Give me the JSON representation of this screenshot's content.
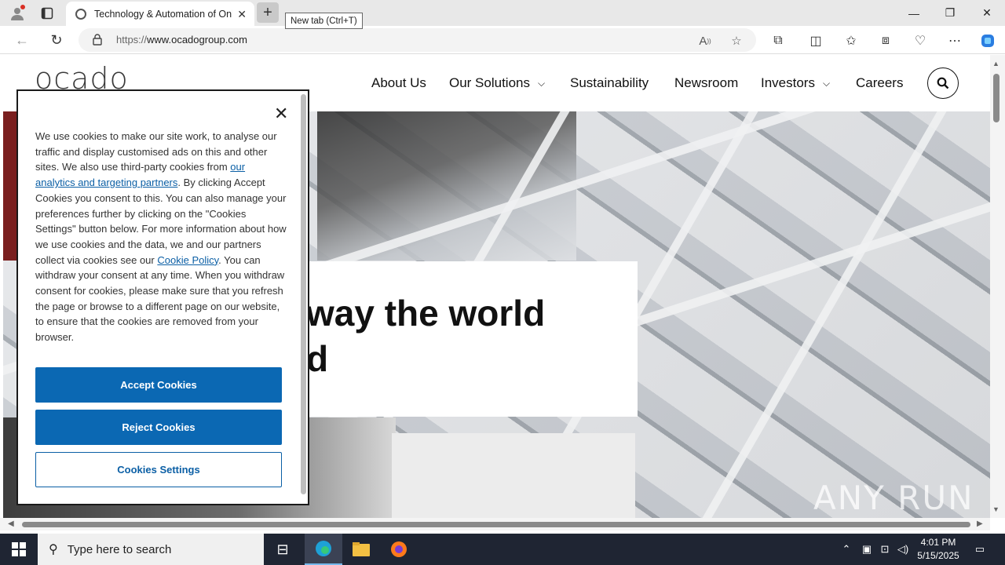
{
  "browser": {
    "tab_title": "Technology & Automation of Online Grocery",
    "tooltip": "New tab (Ctrl+T)",
    "url_prefix": "https://",
    "url_host": "www.ocadogroup.com"
  },
  "site": {
    "logo": "ocado",
    "nav": [
      "About Us",
      "Our Solutions",
      "Sustainability",
      "Newsroom",
      "Investors",
      "Careers"
    ],
    "hero_text": "way the world\nd"
  },
  "cookie": {
    "text_1": "We use cookies to make our site work, to analyse our traffic and display customised ads on this and other sites. We also use third-party cookies from ",
    "link_1": "our analytics and targeting partners",
    "text_2": ". By clicking Accept Cookies you consent to this. You can also manage your preferences further by clicking on the \"Cookies Settings\" button below. For more information about how we use cookies and the data, we and our partners collect via cookies see our ",
    "link_2": "Cookie Policy",
    "text_3": ". You can withdraw your consent at any time. When you withdraw consent for cookies, please make sure that you refresh the page or browse to a different page on our website, to ensure that the cookies are removed from your browser.",
    "accept": "Accept Cookies",
    "reject": "Reject Cookies",
    "settings": "Cookies Settings"
  },
  "watermark": "ANY RUN",
  "taskbar": {
    "search_placeholder": "Type here to search",
    "time": "4:01 PM",
    "date": "5/15/2025"
  },
  "colors": {
    "accent": "#0b68b3",
    "taskbar": "#1f2533"
  }
}
